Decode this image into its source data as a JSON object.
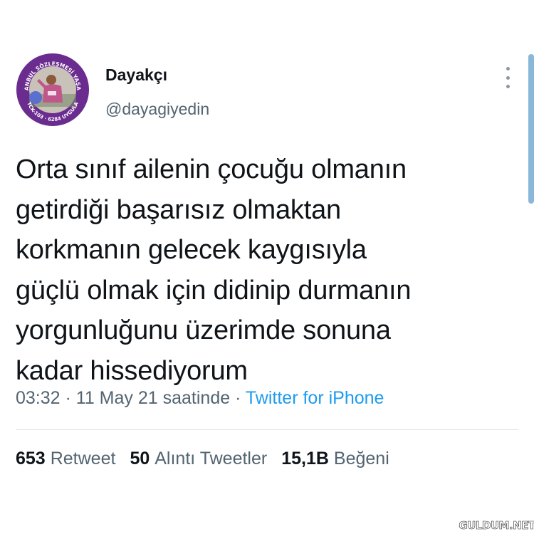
{
  "author": {
    "display_name": "Dayakçı",
    "handle": "@dayagiyedin",
    "avatar_text": "İSTANBUL SÖZLEŞMESİ YAŞATIR · TCK-103 · 6284 UYGULA"
  },
  "tweet": {
    "lines": [
      "Orta sınıf ailenin çocuğu olmanın",
      "getirdiği başarısız olmaktan",
      "korkmanın gelecek kaygısıyla",
      "güçlü olmak için didinip durmanın",
      "yorgunluğunu üzerimde sonuna",
      "kadar hissediyorum"
    ]
  },
  "meta": {
    "time": "03:32",
    "sep1": " · ",
    "date": "11 May 21 saatinde",
    "sep2": " · ",
    "source": "Twitter for iPhone"
  },
  "stats": {
    "retweets_count": "653",
    "retweets_label": "Retweet",
    "quotes_count": "50",
    "quotes_label": "Alıntı Tweetler",
    "likes_count": "15,1B",
    "likes_label": "Beğeni"
  },
  "watermark": "GULDUM.NET",
  "colors": {
    "text": "#0f1419",
    "secondary": "#536471",
    "link": "#1d9bf0",
    "avatar_ring": "#6b2c8f"
  }
}
